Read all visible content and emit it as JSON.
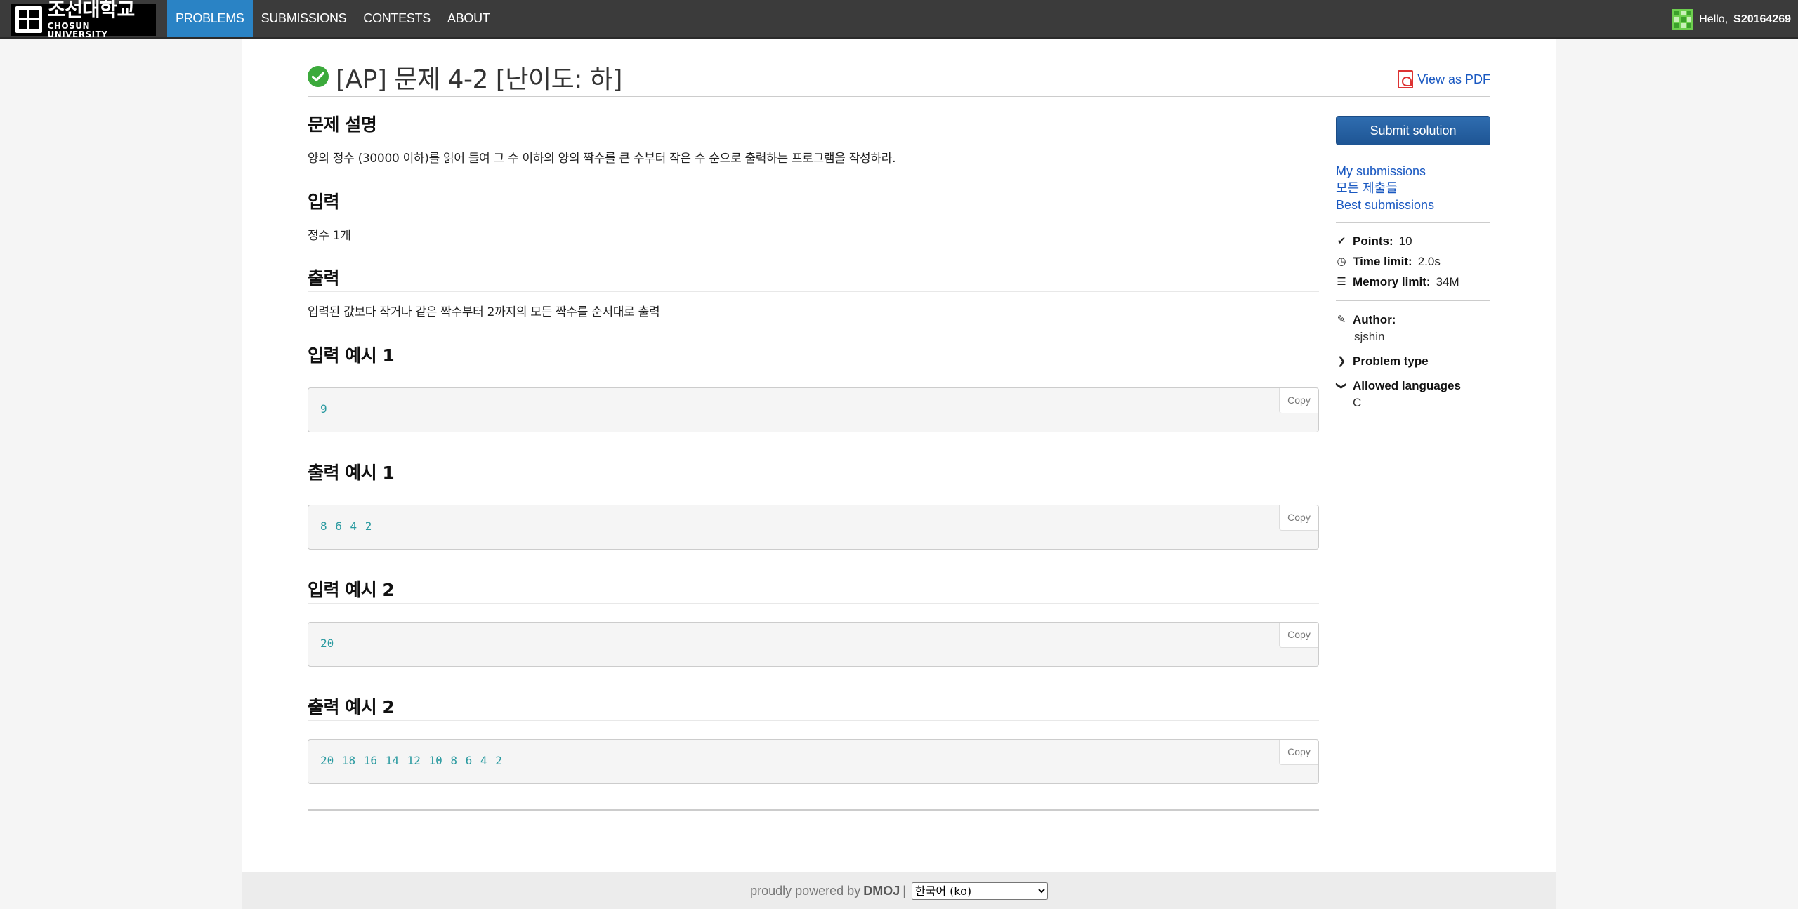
{
  "navbar": {
    "logo_ko": "조선대학교",
    "logo_en": "CHOSUN UNIVERSITY",
    "items": [
      {
        "label": "PROBLEMS",
        "active": true
      },
      {
        "label": "SUBMISSIONS",
        "active": false
      },
      {
        "label": "CONTESTS",
        "active": false
      },
      {
        "label": "ABOUT",
        "active": false
      }
    ],
    "greeting": "Hello,",
    "username": "S20164269"
  },
  "problem": {
    "title": "[AP] 문제 4-2 [난이도: 하]",
    "pdf_label": "View as PDF",
    "sections": {
      "description_heading": "문제 설명",
      "description_text": "양의 정수 (30000 이하)를 읽어 들여 그 수 이하의 양의 짝수를 큰 수부터 작은 수 순으로 출력하는 프로그램을 작성하라.",
      "input_heading": "입력",
      "input_text": "정수 1개",
      "output_heading": "출력",
      "output_text": "입력된 값보다 작거나 같은 짝수부터 2까지의 모든 짝수를 순서대로 출력"
    },
    "examples": [
      {
        "heading": "입력 예시 1",
        "code": "9"
      },
      {
        "heading": "출력 예시 1",
        "code": "8 6 4 2"
      },
      {
        "heading": "입력 예시 2",
        "code": "20"
      },
      {
        "heading": "출력 예시 2",
        "code": "20 18 16 14 12 10 8 6 4 2"
      }
    ],
    "copy_label": "Copy"
  },
  "sidebar": {
    "submit_label": "Submit solution",
    "links": [
      "My submissions",
      "모든 제출들",
      "Best submissions"
    ],
    "points_label": "Points:",
    "points_value": "10",
    "time_label": "Time limit:",
    "time_value": "2.0s",
    "memory_label": "Memory limit:",
    "memory_value": "34M",
    "author_label": "Author:",
    "author_value": "sjshin",
    "problem_type_label": "Problem type",
    "languages_label": "Allowed languages",
    "languages_value": "C"
  },
  "footer": {
    "text": "proudly powered by",
    "brand": "DMOJ",
    "separator": "|",
    "language_selected": "한국어 (ko)"
  },
  "colors": {
    "navbar_bg": "#3b3b3b",
    "active_tab": "#2a83c5",
    "link": "#1958c1",
    "solved_check": "#3caa3c",
    "code_text": "#2a9aa0"
  }
}
